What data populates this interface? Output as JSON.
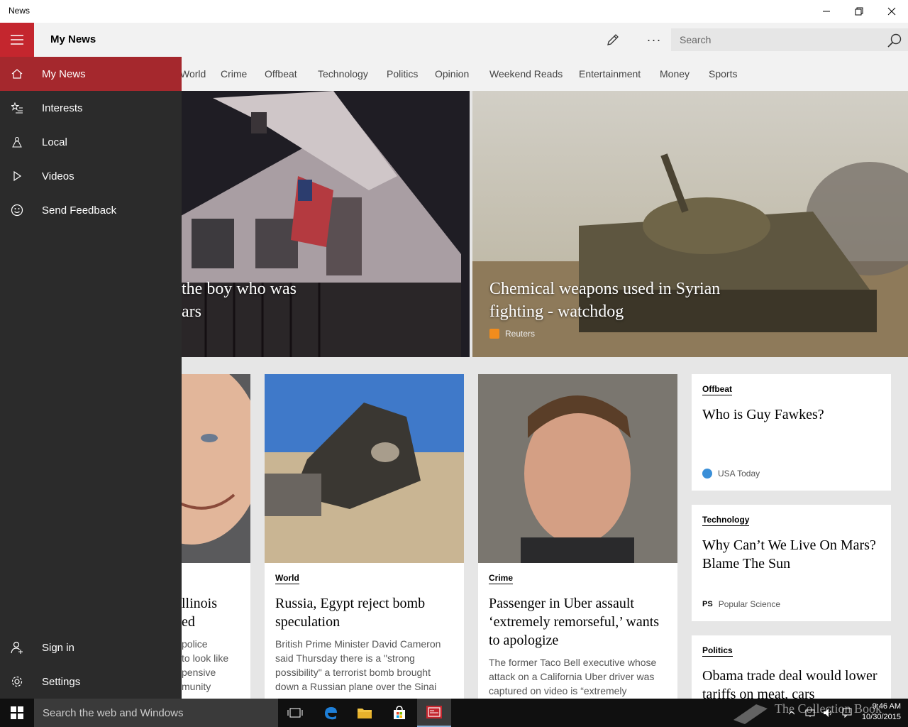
{
  "window": {
    "title": "News"
  },
  "appbar": {
    "page_title": "My News",
    "search_placeholder": "Search",
    "more_label": "···"
  },
  "categories": [
    "World",
    "Crime",
    "Offbeat",
    "Technology",
    "Politics",
    "Opinion",
    "Weekend Reads",
    "Entertainment",
    "Money",
    "Sports"
  ],
  "hero": [
    {
      "title_line1": "the boy who was",
      "title_line2": "ars"
    },
    {
      "title_line1": "Chemical weapons used in Syrian",
      "title_line2": "fighting - watchdog",
      "source": "Reuters"
    }
  ],
  "cards": [
    {
      "title_line1": "llinois",
      "title_line2": "ed",
      "snippet": [
        "police",
        "to look like",
        "pensive",
        "munity"
      ]
    },
    {
      "category": "World",
      "title": "Russia, Egypt reject bomb speculation",
      "snippet": "British Prime Minister David Cameron said Thursday there is a \"strong possibility\" a terrorist bomb brought down a Russian plane over the Sinai"
    },
    {
      "category": "Crime",
      "title": "Passenger in Uber assault ‘extremely remorseful,’ wants to apologize",
      "snippet": "The former Taco Bell executive whose attack on a California Uber driver was captured on video is “extremely"
    }
  ],
  "side_cards": [
    {
      "category": "Offbeat",
      "title": "Who is Guy Fawkes?",
      "source": "USA Today"
    },
    {
      "category": "Technology",
      "title": "Why Can’t We Live On Mars? Blame The Sun",
      "source": "Popular Science",
      "source_icon_text": "PS"
    },
    {
      "category": "Politics",
      "title": "Obama trade deal would lower tariffs on meat, cars"
    }
  ],
  "drawer": {
    "items": [
      {
        "label": "My News",
        "icon": "home-icon",
        "active": true
      },
      {
        "label": "Interests",
        "icon": "star-list-icon"
      },
      {
        "label": "Local",
        "icon": "local-icon"
      },
      {
        "label": "Videos",
        "icon": "play-icon"
      },
      {
        "label": "Send Feedback",
        "icon": "smiley-icon"
      }
    ],
    "bottom": [
      {
        "label": "Sign in",
        "icon": "person-add-icon"
      },
      {
        "label": "Settings",
        "icon": "gear-icon"
      }
    ]
  },
  "taskbar": {
    "search_placeholder": "Search the web and Windows",
    "time": "9:46 AM",
    "date": "10/30/2015"
  },
  "watermark": "The Collection Book",
  "colors": {
    "accent": "#c4262e",
    "drawer_bg": "#2b2b2b",
    "active_item": "#a5282d"
  }
}
